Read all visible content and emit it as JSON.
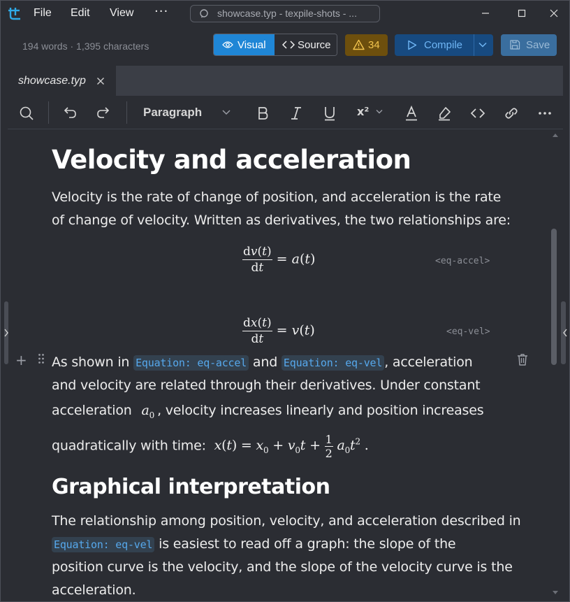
{
  "menu": {
    "file": "File",
    "edit": "Edit",
    "view": "View",
    "more": "···"
  },
  "search": {
    "text": "showcase.typ - texpile-shots - ..."
  },
  "toolbar": {
    "stats": "194 words · 1,395 characters",
    "visual_label": "Visual",
    "source_label": "Source",
    "warning_count": "34",
    "compile_label": "Compile",
    "save_label": "Save"
  },
  "tabs": [
    {
      "label": "showcase.typ"
    }
  ],
  "format": {
    "block_type": "Paragraph",
    "superscript": "x²"
  },
  "doc": {
    "heading1": "Velocity and acceleration",
    "p1": "Velocity is the rate of change of position, and acceleration is the rate of change of velocity. Written as derivatives, the two relationships are:",
    "eq1_label": "<eq-accel>",
    "eq2_label": "<eq-vel>",
    "p2_a": "As shown in",
    "ref_accel": "Equation: eq-accel",
    "p2_and": "and",
    "ref_vel": "Equation: eq-vel",
    "p2_b": ", acceleration",
    "p2_line2": "and velocity are related through their derivatives. Under constant",
    "p2_line3a": "acceleration",
    "p2_line3b": ", velocity increases linearly and position increases",
    "p2_line4": "quadratically with time:",
    "heading2": "Graphical interpretation",
    "p3_line1": "The relationship among position, velocity, and acceleration described in",
    "p3_ref": "Equation: eq-vel",
    "p3_line2": "is easiest to read off a graph: the slope of the",
    "p3_line3": "position curve is the velocity, and the slope of the velocity curve is the",
    "p3_line4": "acceleration."
  },
  "colors": {
    "accent": "#1f86d6",
    "warning": "#6d4f0d",
    "compile": "#174a80",
    "ref": "#56a8ec"
  }
}
